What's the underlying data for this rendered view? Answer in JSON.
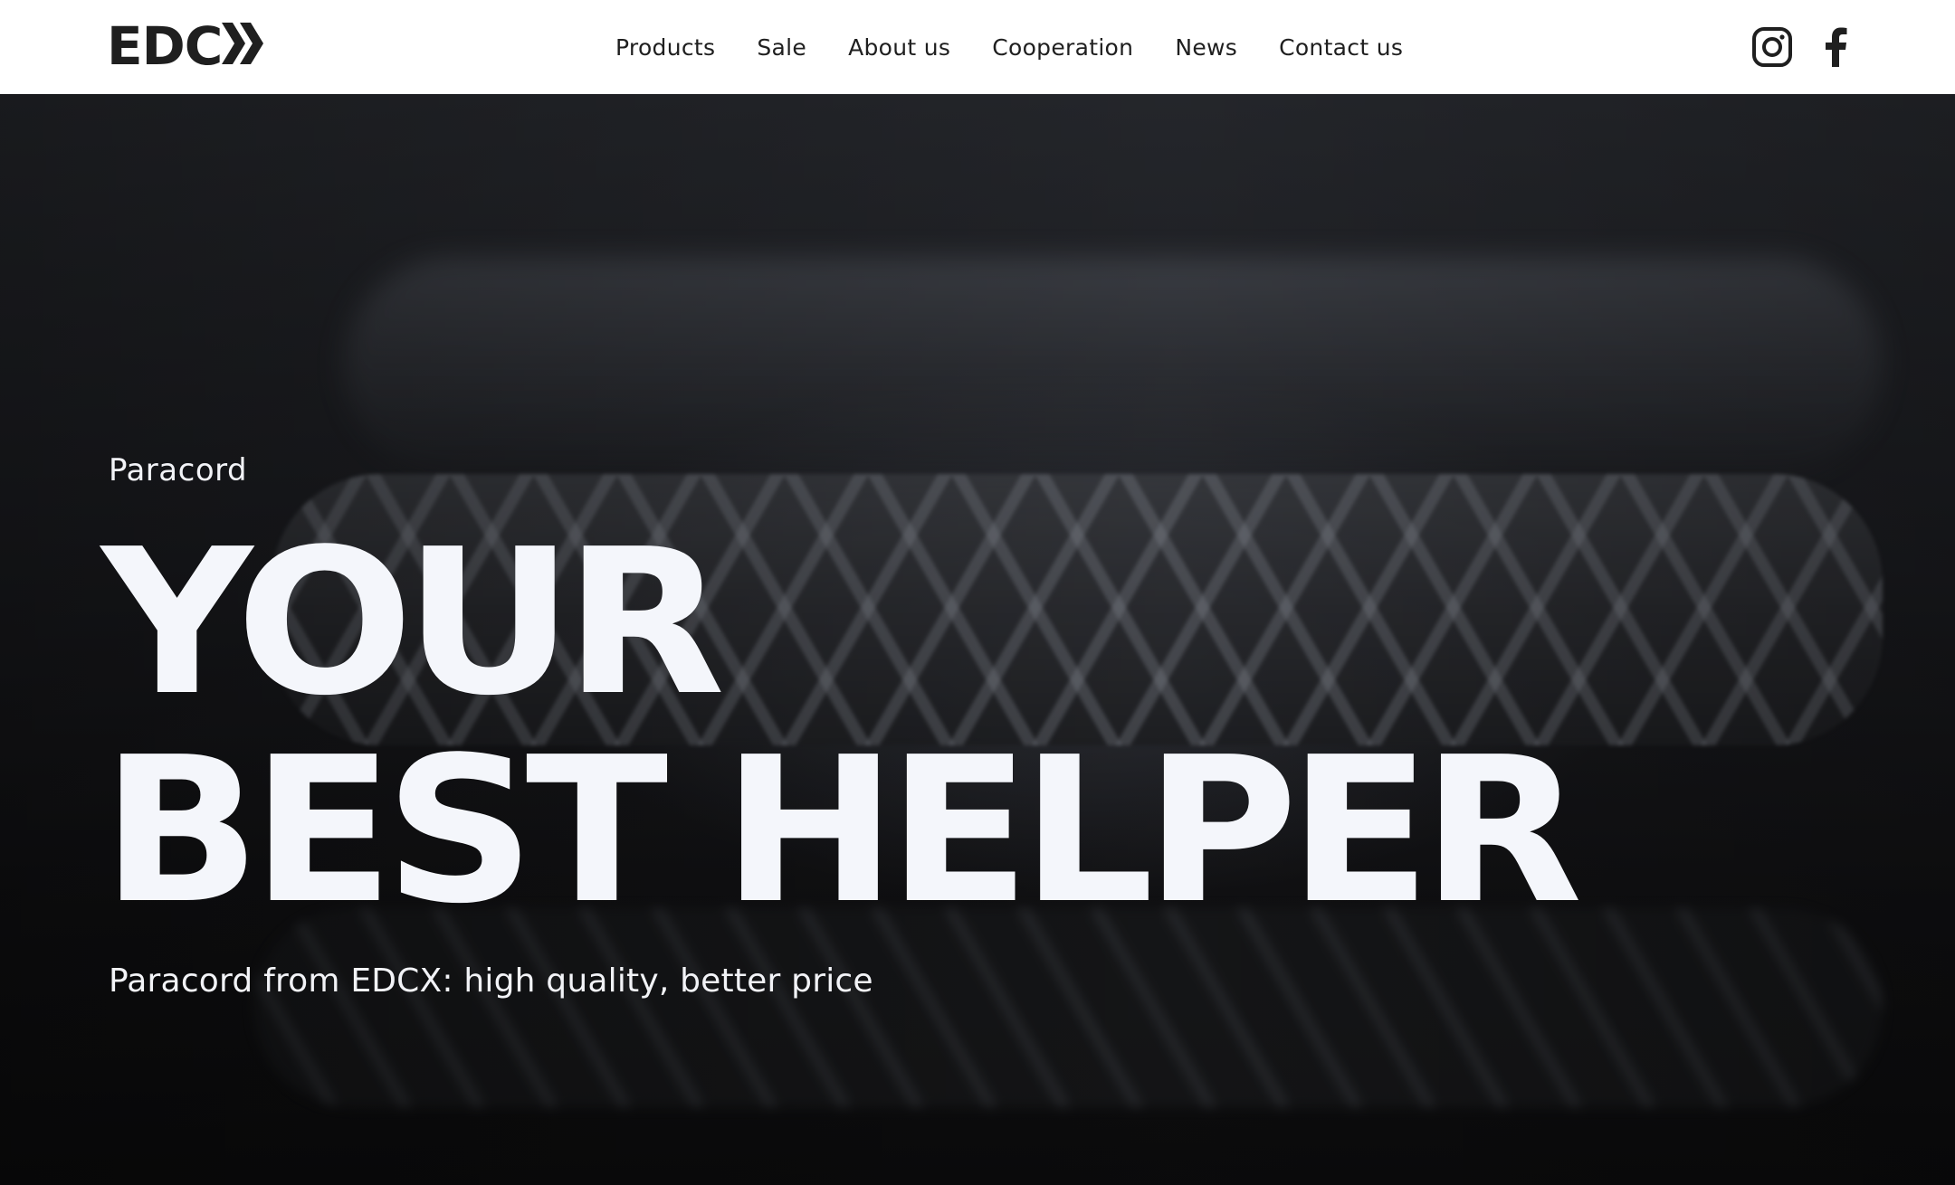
{
  "header": {
    "logo_text": "EDC",
    "logo_mark": "chevrons-x-mark",
    "nav": [
      {
        "label": "Products"
      },
      {
        "label": "Sale"
      },
      {
        "label": "About us"
      },
      {
        "label": "Cooperation"
      },
      {
        "label": "News"
      },
      {
        "label": "Contact us"
      }
    ],
    "socials": [
      {
        "icon": "instagram-icon"
      },
      {
        "icon": "facebook-icon"
      }
    ]
  },
  "hero": {
    "eyebrow": "Paracord",
    "headline_line1": "YOUR",
    "headline_line2": "BEST HELPER",
    "subline": "Paracord from EDCX: high quality, better price"
  },
  "colors": {
    "header_bg": "#ffffff",
    "nav_text": "#1f1f1f",
    "hero_text": "#f4f6fb",
    "hero_bg": "#141416"
  }
}
